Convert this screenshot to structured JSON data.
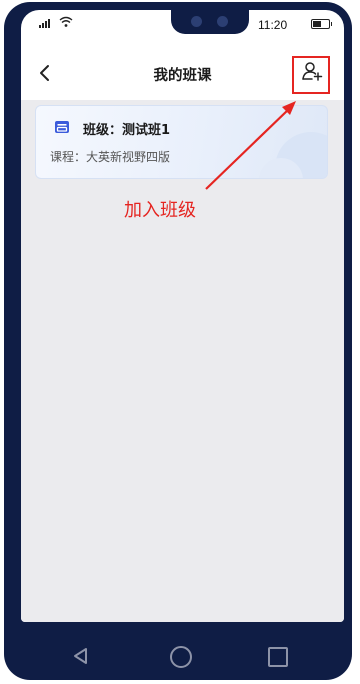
{
  "status_bar": {
    "time": "11:20"
  },
  "header": {
    "title": "我的班课"
  },
  "class_card": {
    "class_label": "班级：",
    "class_name": "测试班1",
    "course_label": "课程：",
    "course_name": "大英新视野四版"
  },
  "annotation": {
    "text": "加入班级",
    "color": "#e52521"
  },
  "colors": {
    "frame": "#0f1d45",
    "content_bg": "#ebebee",
    "accent": "#3b5bdb"
  },
  "icons": [
    "back-arrow-icon",
    "add-user-icon",
    "class-icon",
    "wifi-icon",
    "signal-icon",
    "battery-icon",
    "nav-back-icon",
    "nav-home-icon",
    "nav-recent-icon"
  ]
}
